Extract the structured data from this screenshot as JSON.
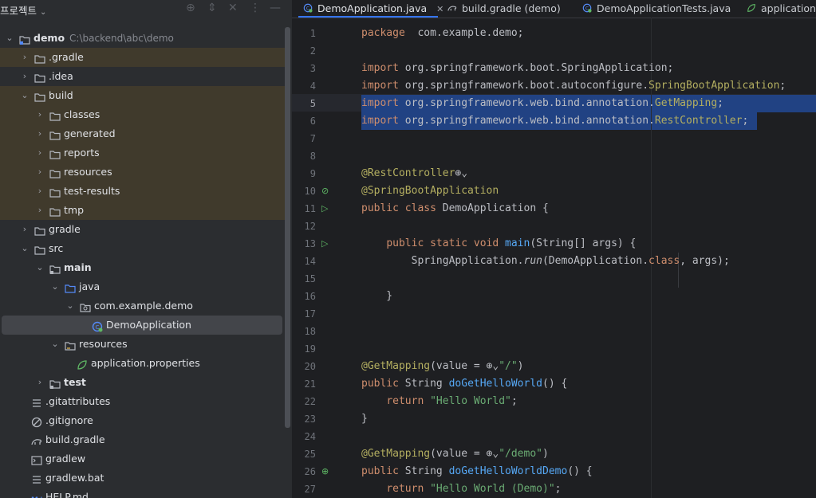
{
  "project_panel": {
    "title": "프로젝트",
    "tree": [
      {
        "label": "demo",
        "path": "C:\\backend\\abc\\demo",
        "depth": 0,
        "arrow": "open",
        "icon": "module-folder",
        "bold": true,
        "highlight": false
      },
      {
        "label": ".gradle",
        "depth": 1,
        "arrow": "closed",
        "icon": "folder",
        "highlight": true
      },
      {
        "label": ".idea",
        "depth": 1,
        "arrow": "closed",
        "icon": "folder",
        "highlight": false
      },
      {
        "label": "build",
        "depth": 1,
        "arrow": "open",
        "icon": "folder",
        "highlight": true
      },
      {
        "label": "classes",
        "depth": 2,
        "arrow": "closed",
        "icon": "folder",
        "highlight": true
      },
      {
        "label": "generated",
        "depth": 2,
        "arrow": "closed",
        "icon": "folder",
        "highlight": true
      },
      {
        "label": "reports",
        "depth": 2,
        "arrow": "closed",
        "icon": "folder",
        "highlight": true
      },
      {
        "label": "resources",
        "depth": 2,
        "arrow": "closed",
        "icon": "folder",
        "highlight": true
      },
      {
        "label": "test-results",
        "depth": 2,
        "arrow": "closed",
        "icon": "folder",
        "highlight": true
      },
      {
        "label": "tmp",
        "depth": 2,
        "arrow": "closed",
        "icon": "folder",
        "highlight": true
      },
      {
        "label": "gradle",
        "depth": 1,
        "arrow": "closed",
        "icon": "folder",
        "highlight": false
      },
      {
        "label": "src",
        "depth": 1,
        "arrow": "open",
        "icon": "folder",
        "highlight": false
      },
      {
        "label": "main",
        "depth": 2,
        "arrow": "open",
        "icon": "source-folder",
        "bold": true,
        "highlight": false
      },
      {
        "label": "java",
        "depth": 3,
        "arrow": "open",
        "icon": "java-folder",
        "highlight": false
      },
      {
        "label": "com.example.demo",
        "depth": 4,
        "arrow": "open",
        "icon": "package",
        "highlight": false
      },
      {
        "label": "DemoApplication",
        "depth": 5,
        "arrow": "none",
        "icon": "spring-class",
        "highlight": false,
        "selected": true
      },
      {
        "label": "resources",
        "depth": 3,
        "arrow": "open",
        "icon": "resources-folder",
        "highlight": false
      },
      {
        "label": "application.properties",
        "depth": 4,
        "arrow": "none",
        "icon": "spring-properties",
        "highlight": false
      },
      {
        "label": "test",
        "depth": 2,
        "arrow": "closed",
        "icon": "source-folder",
        "bold": true,
        "highlight": false
      },
      {
        "label": ".gitattributes",
        "depth": 1,
        "arrow": "none",
        "icon": "lines-file",
        "highlight": false
      },
      {
        "label": ".gitignore",
        "depth": 1,
        "arrow": "none",
        "icon": "ignore-file",
        "highlight": false
      },
      {
        "label": "build.gradle",
        "depth": 1,
        "arrow": "none",
        "icon": "gradle-elephant",
        "highlight": false
      },
      {
        "label": "gradlew",
        "depth": 1,
        "arrow": "none",
        "icon": "terminal-file",
        "highlight": false
      },
      {
        "label": "gradlew.bat",
        "depth": 1,
        "arrow": "none",
        "icon": "lines-file",
        "highlight": false
      },
      {
        "label": "HELP.md",
        "depth": 1,
        "arrow": "none",
        "icon": "markdown-file",
        "highlight": false
      }
    ]
  },
  "tabs": [
    {
      "label": "DemoApplication.java",
      "icon": "spring-class",
      "active": true,
      "closable": true
    },
    {
      "label": "build.gradle (demo)",
      "icon": "gradle-elephant",
      "active": false
    },
    {
      "label": "DemoApplicationTests.java",
      "icon": "spring-class",
      "active": false
    },
    {
      "label": "application.p",
      "icon": "spring-properties",
      "active": false
    }
  ],
  "editor": {
    "current_line": 5,
    "lines": [
      {
        "n": "1",
        "tokens": [
          [
            "kw",
            "package"
          ],
          [
            "",
            "  com.example.demo;"
          ]
        ]
      },
      {
        "n": "2",
        "tokens": []
      },
      {
        "n": "3",
        "tokens": [
          [
            "kw",
            "import"
          ],
          [
            "",
            " org.springframework.boot.SpringApplication;"
          ]
        ]
      },
      {
        "n": "4",
        "tokens": [
          [
            "kw",
            "import"
          ],
          [
            "",
            " org.springframework.boot.autoconfigure."
          ],
          [
            "ann",
            "SpringBootApplication"
          ],
          [
            "",
            ";"
          ]
        ]
      },
      {
        "n": "5",
        "tokens": [
          [
            "kw",
            "import"
          ],
          [
            "",
            " org.springframework.web.bind.annotation."
          ],
          [
            "ann",
            "GetMapping"
          ],
          [
            "",
            ";"
          ]
        ]
      },
      {
        "n": "6",
        "tokens": [
          [
            "kw",
            "import"
          ],
          [
            "",
            " org.springframework.web.bind.annotation."
          ],
          [
            "ann",
            "RestController"
          ],
          [
            "",
            ";"
          ]
        ]
      },
      {
        "n": "7",
        "tokens": []
      },
      {
        "n": "8",
        "tokens": []
      },
      {
        "n": "9",
        "tokens": [
          [
            "ann",
            "@RestController"
          ],
          [
            "",
            "⊕⌄"
          ]
        ]
      },
      {
        "n": "10",
        "tokens": [
          [
            "ann",
            "@SpringBootApplication"
          ]
        ]
      },
      {
        "n": "11",
        "tokens": [
          [
            "kw",
            "public class"
          ],
          [
            "",
            " DemoApplication {"
          ]
        ]
      },
      {
        "n": "12",
        "tokens": []
      },
      {
        "n": "13",
        "tokens": [
          [
            "",
            "    "
          ],
          [
            "kw",
            "public static void"
          ],
          [
            "",
            " "
          ],
          [
            "fn",
            "main"
          ],
          [
            "",
            "(String[] args) {"
          ]
        ]
      },
      {
        "n": "14",
        "tokens": [
          [
            "",
            "        SpringApplication."
          ],
          [
            "it",
            "run"
          ],
          [
            "",
            "(DemoApplication."
          ],
          [
            "kw",
            "class"
          ],
          [
            "",
            ", args);"
          ]
        ]
      },
      {
        "n": "15",
        "tokens": []
      },
      {
        "n": "16",
        "tokens": [
          [
            "",
            "    }"
          ]
        ]
      },
      {
        "n": "17",
        "tokens": []
      },
      {
        "n": "18",
        "tokens": []
      },
      {
        "n": "19",
        "tokens": []
      },
      {
        "n": "20",
        "tokens": [
          [
            "ann",
            "@GetMapping"
          ],
          [
            "",
            "(value = ⊕⌄"
          ],
          [
            "str",
            "\"/\""
          ],
          [
            "",
            ")"
          ]
        ]
      },
      {
        "n": "21",
        "tokens": [
          [
            "kw",
            "public"
          ],
          [
            "",
            " String "
          ],
          [
            "fn",
            "doGetHelloWorld"
          ],
          [
            "",
            "() {"
          ]
        ]
      },
      {
        "n": "22",
        "tokens": [
          [
            "",
            "    "
          ],
          [
            "kw",
            "return"
          ],
          [
            "",
            " "
          ],
          [
            "str",
            "\"Hello World\""
          ],
          [
            "",
            ";"
          ]
        ]
      },
      {
        "n": "23",
        "tokens": [
          [
            "",
            "}"
          ]
        ]
      },
      {
        "n": "24",
        "tokens": []
      },
      {
        "n": "25",
        "tokens": [
          [
            "ann",
            "@GetMapping"
          ],
          [
            "",
            "(value = ⊕⌄"
          ],
          [
            "str",
            "\"/demo\""
          ],
          [
            "",
            ")"
          ]
        ]
      },
      {
        "n": "26",
        "tokens": [
          [
            "kw",
            "public"
          ],
          [
            "",
            " String "
          ],
          [
            "fn",
            "doGetHelloWorldDemo"
          ],
          [
            "",
            "() {"
          ]
        ]
      },
      {
        "n": "27",
        "tokens": [
          [
            "",
            "    "
          ],
          [
            "kw",
            "return"
          ],
          [
            "",
            " "
          ],
          [
            "str",
            "\"Hello World (Demo)\""
          ],
          [
            "",
            ";"
          ]
        ]
      }
    ]
  },
  "colors": {
    "panel_bg": "#2b2d30",
    "editor_bg": "#1e1f22",
    "highlight_row": "#403a2c",
    "selection": "#214283",
    "keyword": "#cf8e6d",
    "annotation": "#b3ae60",
    "string": "#6aab73",
    "function": "#56a8f5",
    "accent": "#3574f0"
  }
}
